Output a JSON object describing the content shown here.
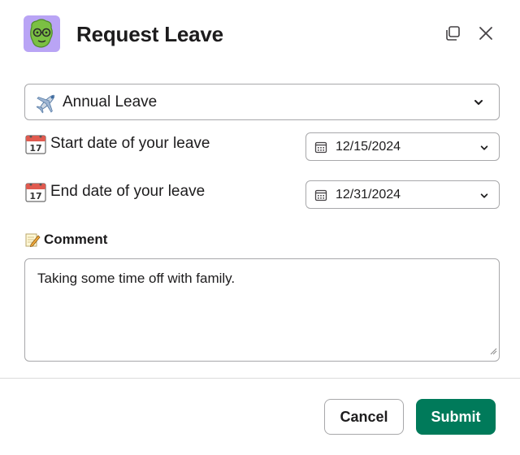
{
  "dialog": {
    "title": "Request Leave",
    "app_icon": "green-face-with-glasses-icon",
    "header_buttons": [
      "copy-icon",
      "close-icon"
    ]
  },
  "leave_type": {
    "icon": "airplane-emoji-icon",
    "selected": "Annual Leave"
  },
  "start": {
    "label": "Start date of your leave",
    "value": "12/15/2024"
  },
  "end": {
    "label": "End date of your leave",
    "value": "12/31/2024"
  },
  "comment": {
    "label": "Comment",
    "value": "Taking some time off with family."
  },
  "footer": {
    "cancel_label": "Cancel",
    "submit_label": "Submit"
  },
  "colors": {
    "accent": "#007a5a",
    "app_icon_bg": "#b9a4f5",
    "border": "#a8a8aa"
  }
}
